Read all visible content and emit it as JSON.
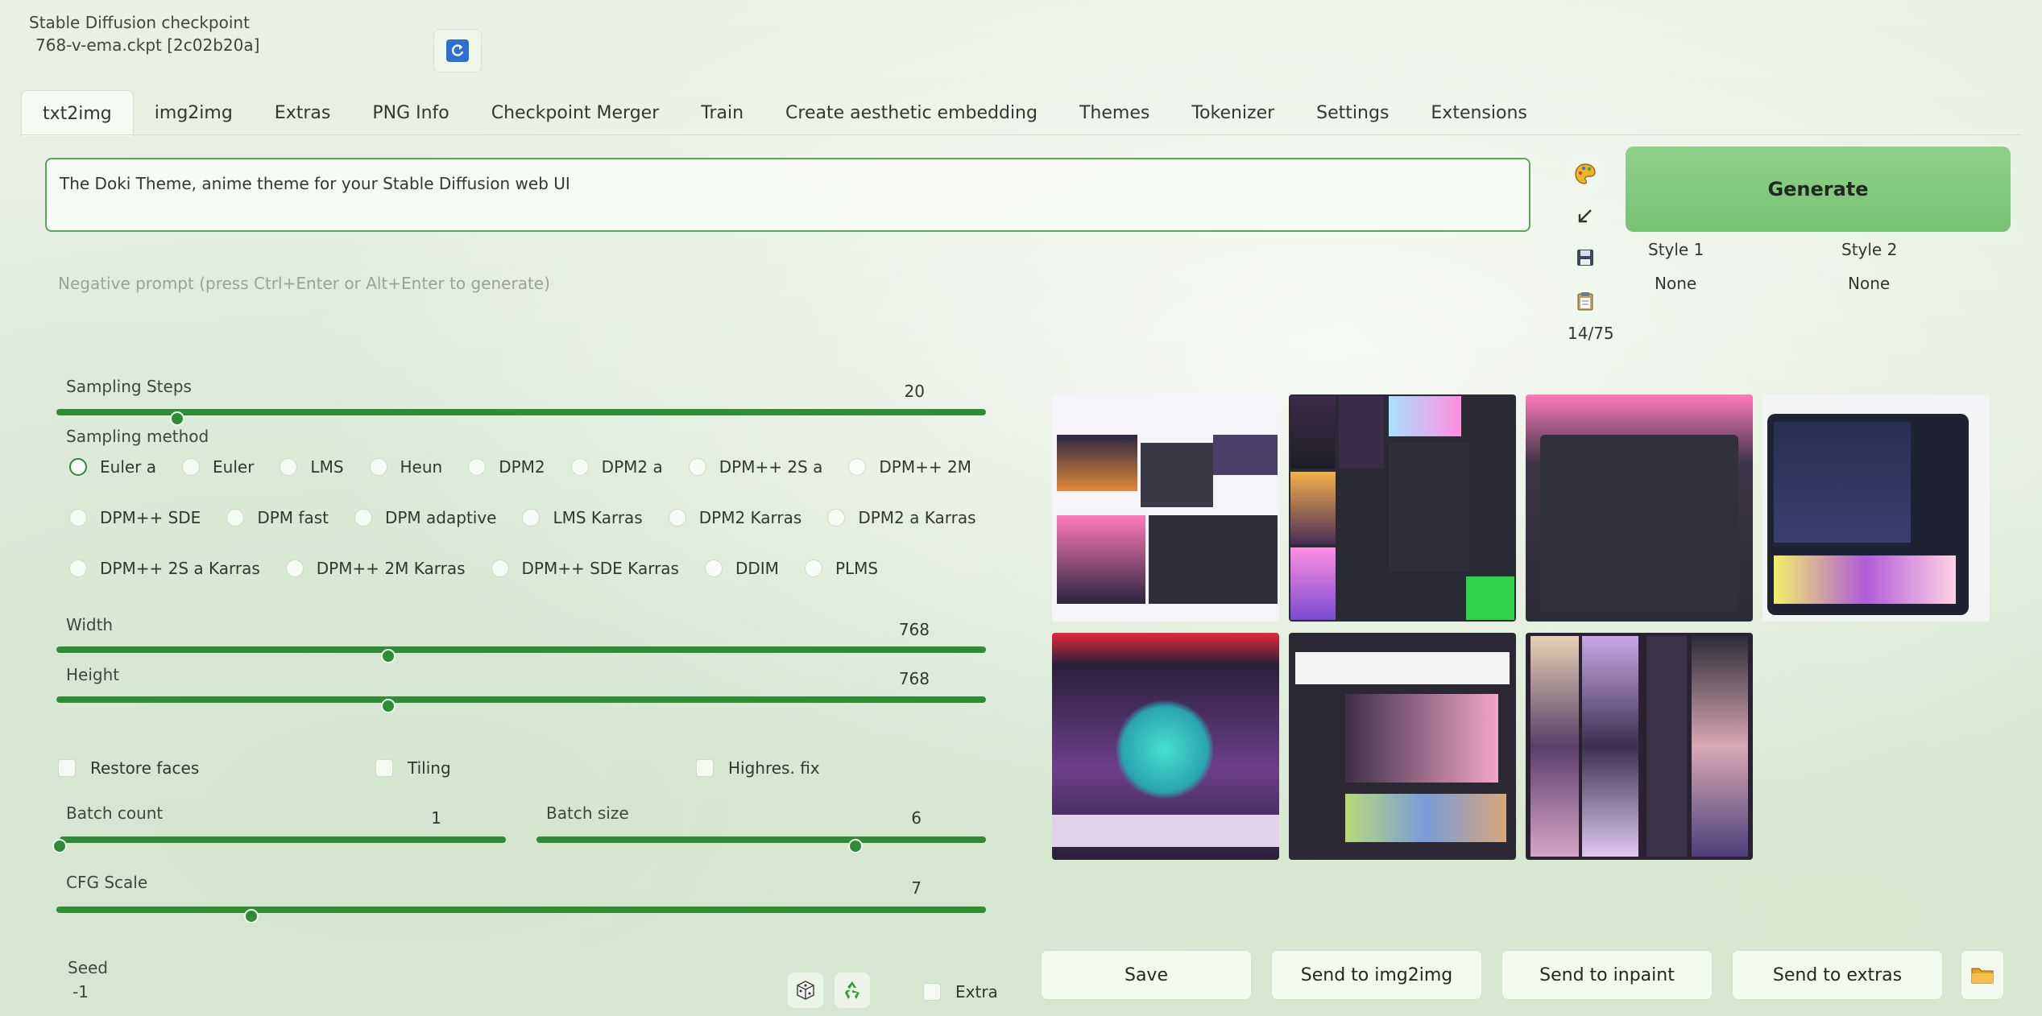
{
  "checkpoint": {
    "label": "Stable Diffusion checkpoint",
    "value": "768-v-ema.ckpt [2c02b20a]"
  },
  "tabs": [
    "txt2img",
    "img2img",
    "Extras",
    "PNG Info",
    "Checkpoint Merger",
    "Train",
    "Create aesthetic embedding",
    "Themes",
    "Tokenizer",
    "Settings",
    "Extensions"
  ],
  "active_tab": "txt2img",
  "prompt": {
    "text": "The Doki Theme, anime theme for your Stable Diffusion web UI"
  },
  "negative_prompt": {
    "placeholder": "Negative prompt (press Ctrl+Enter or Alt+Enter to generate)"
  },
  "token_count": "14/75",
  "generate_label": "Generate",
  "styles": [
    {
      "label": "Style 1",
      "value": "None"
    },
    {
      "label": "Style 2",
      "value": "None"
    }
  ],
  "sampling_steps": {
    "label": "Sampling Steps",
    "value": "20",
    "fraction": 0.13
  },
  "sampling_method": {
    "label": "Sampling method",
    "selected": "Euler a",
    "rows": [
      [
        "Euler a",
        "Euler",
        "LMS",
        "Heun",
        "DPM2",
        "DPM2 a",
        "DPM++ 2S a",
        "DPM++ 2M"
      ],
      [
        "DPM++ SDE",
        "DPM fast",
        "DPM adaptive",
        "LMS Karras",
        "DPM2 Karras",
        "DPM2 a Karras"
      ],
      [
        "DPM++ 2S a Karras",
        "DPM++ 2M Karras",
        "DPM++ SDE Karras",
        "DDIM",
        "PLMS"
      ]
    ]
  },
  "width": {
    "label": "Width",
    "value": "768",
    "fraction": 0.357
  },
  "height": {
    "label": "Height",
    "value": "768",
    "fraction": 0.357
  },
  "checkboxes": {
    "restore_faces": "Restore faces",
    "tiling": "Tiling",
    "highres_fix": "Highres. fix",
    "extra": "Extra"
  },
  "batch_count": {
    "label": "Batch count",
    "value": "1",
    "fraction": 0.0
  },
  "batch_size": {
    "label": "Batch size",
    "value": "6",
    "fraction": 0.71
  },
  "cfg_scale": {
    "label": "CFG Scale",
    "value": "7",
    "fraction": 0.21
  },
  "seed": {
    "label": "Seed",
    "value": "-1"
  },
  "icons": {
    "paint": "palette-icon",
    "arrow": "arrow-icon",
    "save": "save-icon",
    "clipboard": "clipboard-icon",
    "refresh": "refresh-icon",
    "dice": "dice-icon",
    "recycle": "recycle-icon",
    "folder": "folder-icon"
  },
  "actions": {
    "save": "Save",
    "send_img2img": "Send to img2img",
    "send_inpaint": "Send to inpaint",
    "send_extras": "Send to extras"
  },
  "colors": {
    "accent": "#2e8b36",
    "generate": "#7fc67a",
    "background": "#e4eddf"
  }
}
